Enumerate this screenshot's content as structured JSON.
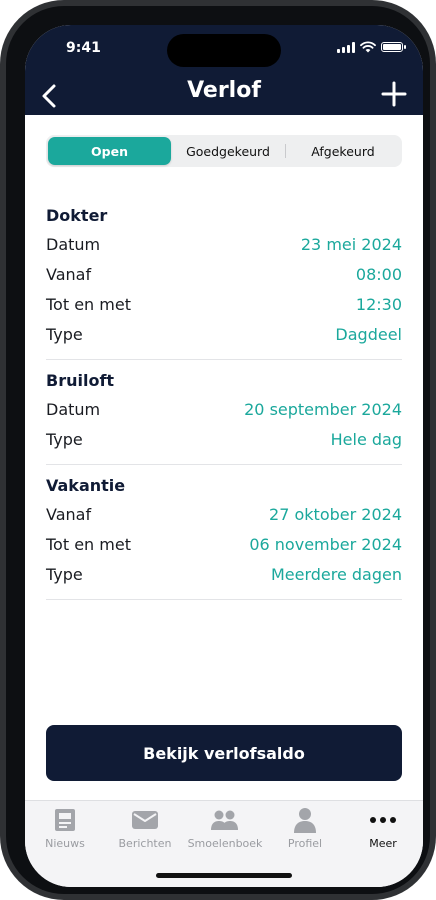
{
  "status_bar": {
    "time": "9:41"
  },
  "header": {
    "title": "Verlof"
  },
  "segments": {
    "open": "Open",
    "approved": "Goedgekeurd",
    "rejected": "Afgekeurd",
    "selected": "Open"
  },
  "leave_items": [
    {
      "title": "Dokter",
      "rows": [
        {
          "label": "Datum",
          "value": "23 mei 2024"
        },
        {
          "label": "Vanaf",
          "value": "08:00"
        },
        {
          "label": "Tot en met",
          "value": "12:30"
        },
        {
          "label": "Type",
          "value": "Dagdeel"
        }
      ]
    },
    {
      "title": "Bruiloft",
      "rows": [
        {
          "label": "Datum",
          "value": "20 september 2024"
        },
        {
          "label": "Type",
          "value": "Hele dag"
        }
      ]
    },
    {
      "title": "Vakantie",
      "rows": [
        {
          "label": "Vanaf",
          "value": "27 oktober 2024"
        },
        {
          "label": "Tot en met",
          "value": "06 november 2024"
        },
        {
          "label": "Type",
          "value": "Meerdere dagen"
        }
      ]
    }
  ],
  "cta": {
    "label": "Bekijk verlofsaldo"
  },
  "tabbar": {
    "tabs": [
      {
        "label": "Nieuws",
        "icon": "news-icon"
      },
      {
        "label": "Berichten",
        "icon": "mail-icon"
      },
      {
        "label": "Smoelenboek",
        "icon": "people-icon"
      },
      {
        "label": "Profiel",
        "icon": "person-icon"
      },
      {
        "label": "Meer",
        "icon": "more-icon"
      }
    ],
    "active": "Meer"
  },
  "colors": {
    "navy": "#101b35",
    "teal": "#1ba89c",
    "tab_inactive": "#9a9ca1"
  }
}
